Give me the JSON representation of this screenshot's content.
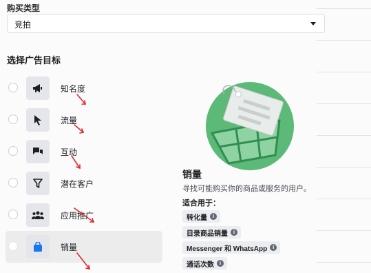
{
  "buy_type": {
    "label": "购买类型",
    "value": "竞拍"
  },
  "objectives": {
    "title": "选择广告目标",
    "items": [
      {
        "label": "知名度",
        "icon": "megaphone-icon",
        "selected": false
      },
      {
        "label": "流量",
        "icon": "cursor-icon",
        "selected": false
      },
      {
        "label": "互动",
        "icon": "chat-bubbles-icon",
        "selected": false
      },
      {
        "label": "潜在客户",
        "icon": "funnel-icon",
        "selected": false
      },
      {
        "label": "应用推广",
        "icon": "people-icon",
        "selected": false
      },
      {
        "label": "销量",
        "icon": "shopping-bag-icon",
        "selected": true
      }
    ]
  },
  "detail": {
    "title": "销量",
    "description": "寻找可能购买你的商品或服务的用户。",
    "suitable_label": "适合用于：",
    "chips": [
      "转化量",
      "目录商品销量",
      "Messenger 和 WhatsApp",
      "通话次数"
    ],
    "info_glyph": "i"
  },
  "colors": {
    "illustration_green": "#5cb978",
    "selected_icon_blue": "#1877f2",
    "annotation_red": "#e0262a"
  }
}
